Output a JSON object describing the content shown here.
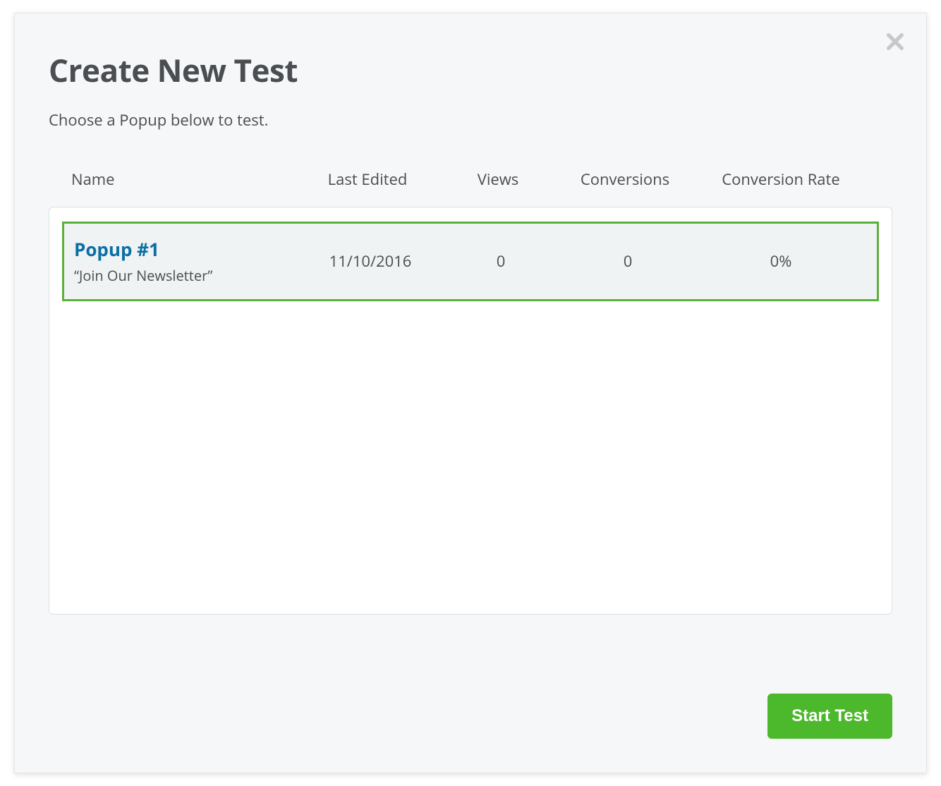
{
  "modal": {
    "title": "Create New Test",
    "subtitle": "Choose a Popup below to test."
  },
  "table": {
    "headers": {
      "name": "Name",
      "last_edited": "Last Edited",
      "views": "Views",
      "conversions": "Conversions",
      "conversion_rate": "Conversion Rate"
    },
    "rows": [
      {
        "title": "Popup #1",
        "description": "“Join Our Newsletter”",
        "last_edited": "11/10/2016",
        "views": "0",
        "conversions": "0",
        "conversion_rate": "0%",
        "selected": true
      }
    ]
  },
  "footer": {
    "start_label": "Start Test"
  }
}
